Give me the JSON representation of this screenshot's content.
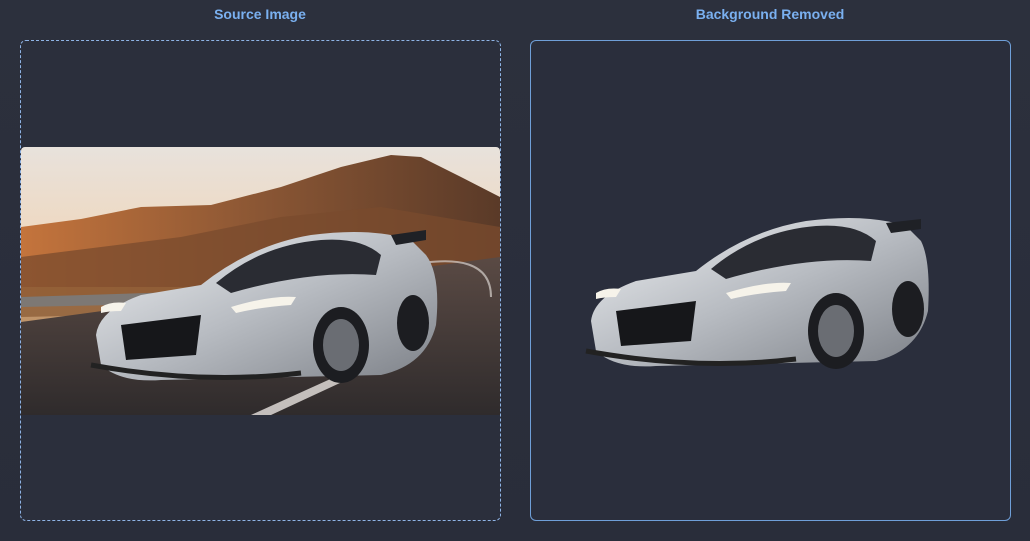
{
  "panels": {
    "source": {
      "title": "Source Image"
    },
    "result": {
      "title": "Background Removed"
    }
  },
  "images": {
    "source": {
      "alt": "Silver sports car driving on a winding mountain road at sunset"
    },
    "result": {
      "alt": "Silver sports car with background removed"
    }
  },
  "colors": {
    "background": "#2b2f3d",
    "title": "#7ab0f0",
    "dropzone_border": "#8fb4e6",
    "result_border": "#6f9fd8"
  }
}
